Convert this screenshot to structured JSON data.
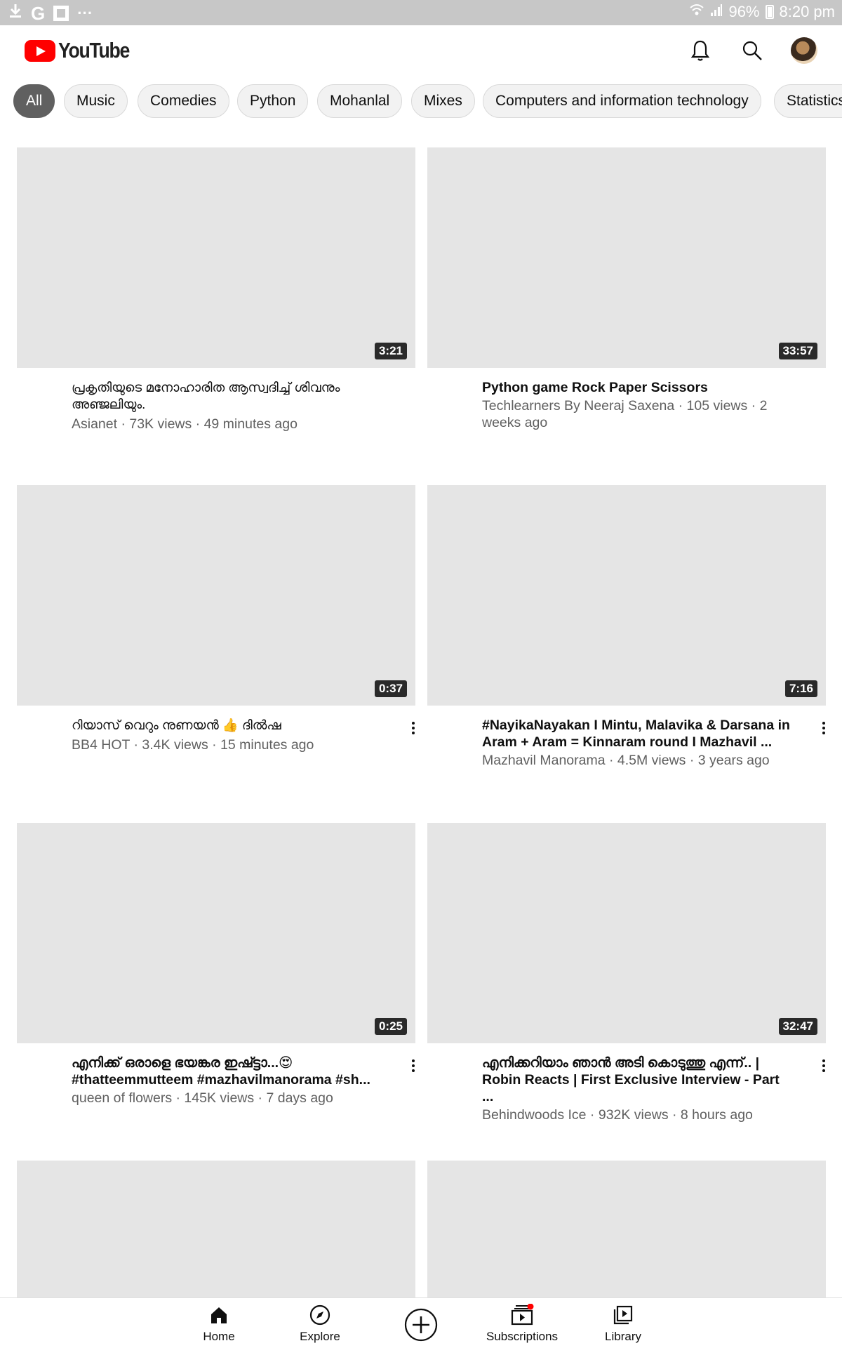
{
  "status_bar": {
    "left_icons": [
      "download-icon",
      "google-icon",
      "flipboard-icon",
      "more-icon"
    ],
    "battery": "96%",
    "time": "8:20 pm"
  },
  "header": {
    "logo_text": "YouTube",
    "icons": [
      "bell-icon",
      "search-icon",
      "avatar"
    ]
  },
  "chips": [
    {
      "label": "All",
      "active": true
    },
    {
      "label": "Music"
    },
    {
      "label": "Comedies"
    },
    {
      "label": "Python"
    },
    {
      "label": "Mohanlal"
    },
    {
      "label": "Mixes"
    },
    {
      "label": "Computers and information technology"
    },
    {
      "label": "Statistics"
    }
  ],
  "videos": [
    {
      "duration": "3:21",
      "title": "പ്രകൃതിയുടെ മനോഹാരിത ആസ്വദിച്ച് ശിവനും അഞ്ജലിയും.",
      "meta": "Asianet · 73K views · 49 minutes ago"
    },
    {
      "duration": "33:57",
      "title": "Python game Rock Paper Scissors",
      "meta": "Techlearners By Neeraj Saxena · 105 views · 2 weeks ago"
    },
    {
      "duration": "0:37",
      "title": "റിയാസ് വെറും നുണയൻ 👍 ദിൽഷ",
      "meta": "BB4 HOT · 3.4K views · 15 minutes ago"
    },
    {
      "duration": "7:16",
      "title": "#NayikaNayakan I Mintu, Malavika & Darsana in Aram + Aram = Kinnaram round I Mazhavil ...",
      "meta": "Mazhavil Manorama · 4.5M views · 3 years ago"
    },
    {
      "duration": "0:25",
      "title": "എനിക്ക് ഒരാളെ ഭയങ്കര ഇഷ്ട്ടാ...😍 #thatteemmutteem #mazhavilmanorama #sh...",
      "meta": "queen of flowers · 145K views · 7 days ago"
    },
    {
      "duration": "32:47",
      "title": "എനിക്കറിയാം ഞാൻ അടി കൊടുത്തു എന്ന്.. | Robin Reacts | First Exclusive Interview - Part ...",
      "meta": "Behindwoods Ice · 932K views · 8 hours ago"
    }
  ],
  "bottom_nav": {
    "home": "Home",
    "explore": "Explore",
    "subscriptions": "Subscriptions",
    "library": "Library"
  }
}
